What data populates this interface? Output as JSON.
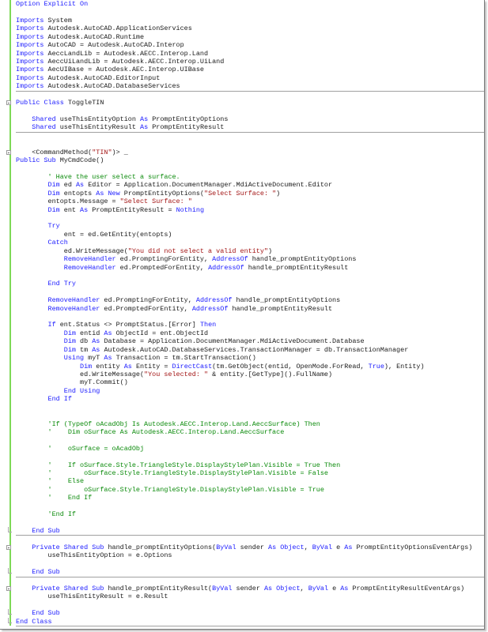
{
  "colors": {
    "keyword": "#1a1aff",
    "string": "#a31515",
    "comment": "#0a8a0a",
    "text": "#1a1a1a"
  },
  "lines": [
    {
      "segs": [
        [
          "k",
          "Option Explicit On"
        ]
      ]
    },
    {
      "segs": []
    },
    {
      "segs": [
        [
          "k",
          "Imports"
        ],
        [
          "p",
          " System"
        ]
      ]
    },
    {
      "segs": [
        [
          "k",
          "Imports"
        ],
        [
          "p",
          " Autodesk.AutoCAD.ApplicationServices"
        ]
      ]
    },
    {
      "segs": [
        [
          "k",
          "Imports"
        ],
        [
          "p",
          " Autodesk.AutoCAD.Runtime"
        ]
      ]
    },
    {
      "segs": [
        [
          "k",
          "Imports"
        ],
        [
          "p",
          " AutoCAD = Autodesk.AutoCAD.Interop"
        ]
      ]
    },
    {
      "segs": [
        [
          "k",
          "Imports"
        ],
        [
          "p",
          " AeccLandLib = Autodesk.AECC.Interop.Land"
        ]
      ]
    },
    {
      "segs": [
        [
          "k",
          "Imports"
        ],
        [
          "p",
          " AeccUiLandLib = Autodesk.AECC.Interop.UiLand"
        ]
      ]
    },
    {
      "segs": [
        [
          "k",
          "Imports"
        ],
        [
          "p",
          " AecUIBase = Autodesk.AEC.Interop.UIBase"
        ]
      ]
    },
    {
      "segs": [
        [
          "k",
          "Imports"
        ],
        [
          "p",
          " Autodesk.AutoCAD.EditorInput"
        ]
      ]
    },
    {
      "segs": [
        [
          "k",
          "Imports"
        ],
        [
          "p",
          " Autodesk.AutoCAD.DatabaseServices"
        ]
      ],
      "sep": true
    },
    {
      "segs": []
    },
    {
      "segs": [
        [
          "k",
          "Public Class"
        ],
        [
          "p",
          " ToggleTIN"
        ]
      ],
      "fold": "open"
    },
    {
      "segs": []
    },
    {
      "segs": [
        [
          "p",
          "    "
        ],
        [
          "k",
          "Shared"
        ],
        [
          "p",
          " useThisEntityOption "
        ],
        [
          "k",
          "As"
        ],
        [
          "p",
          " PromptEntityOptions"
        ]
      ]
    },
    {
      "segs": [
        [
          "p",
          "    "
        ],
        [
          "k",
          "Shared"
        ],
        [
          "p",
          " useThisEntityResult "
        ],
        [
          "k",
          "As"
        ],
        [
          "p",
          " PromptEntityResult"
        ]
      ],
      "sep": true
    },
    {
      "segs": []
    },
    {
      "segs": []
    },
    {
      "segs": [
        [
          "p",
          "    <CommandMethod("
        ],
        [
          "s",
          "\"TIN\""
        ],
        [
          "p",
          ")> _"
        ]
      ],
      "fold": "open"
    },
    {
      "segs": [
        [
          "k",
          "Public Sub"
        ],
        [
          "p",
          " MyCmdCode()"
        ]
      ]
    },
    {
      "segs": []
    },
    {
      "segs": [
        [
          "p",
          "        "
        ],
        [
          "c",
          "' Have the user select a surface."
        ]
      ]
    },
    {
      "segs": [
        [
          "p",
          "        "
        ],
        [
          "k",
          "Dim"
        ],
        [
          "p",
          " ed "
        ],
        [
          "k",
          "As"
        ],
        [
          "p",
          " Editor = Application.DocumentManager.MdiActiveDocument.Editor"
        ]
      ]
    },
    {
      "segs": [
        [
          "p",
          "        "
        ],
        [
          "k",
          "Dim"
        ],
        [
          "p",
          " entopts "
        ],
        [
          "k",
          "As New"
        ],
        [
          "p",
          " PromptEntityOptions("
        ],
        [
          "s",
          "\"Select Surface: \""
        ],
        [
          "p",
          ")"
        ]
      ]
    },
    {
      "segs": [
        [
          "p",
          "        entopts.Message = "
        ],
        [
          "s",
          "\"Select Surface: \""
        ]
      ]
    },
    {
      "segs": [
        [
          "p",
          "        "
        ],
        [
          "k",
          "Dim"
        ],
        [
          "p",
          " ent "
        ],
        [
          "k",
          "As"
        ],
        [
          "p",
          " PromptEntityResult = "
        ],
        [
          "k",
          "Nothing"
        ]
      ]
    },
    {
      "segs": []
    },
    {
      "segs": [
        [
          "p",
          "        "
        ],
        [
          "k",
          "Try"
        ]
      ]
    },
    {
      "segs": [
        [
          "p",
          "            ent = ed.GetEntity(entopts)"
        ]
      ]
    },
    {
      "segs": [
        [
          "p",
          "        "
        ],
        [
          "k",
          "Catch"
        ]
      ]
    },
    {
      "segs": [
        [
          "p",
          "            ed.WriteMessage("
        ],
        [
          "s",
          "\"You did not select a valid entity\""
        ],
        [
          "p",
          ")"
        ]
      ]
    },
    {
      "segs": [
        [
          "p",
          "            "
        ],
        [
          "k",
          "RemoveHandler"
        ],
        [
          "p",
          " ed.PromptingForEntity, "
        ],
        [
          "k",
          "AddressOf"
        ],
        [
          "p",
          " handle_promptEntityOptions"
        ]
      ]
    },
    {
      "segs": [
        [
          "p",
          "            "
        ],
        [
          "k",
          "RemoveHandler"
        ],
        [
          "p",
          " ed.PromptedForEntity, "
        ],
        [
          "k",
          "AddressOf"
        ],
        [
          "p",
          " handle_promptEntityResult"
        ]
      ]
    },
    {
      "segs": []
    },
    {
      "segs": [
        [
          "p",
          "        "
        ],
        [
          "k",
          "End Try"
        ]
      ]
    },
    {
      "segs": []
    },
    {
      "segs": [
        [
          "p",
          "        "
        ],
        [
          "k",
          "RemoveHandler"
        ],
        [
          "p",
          " ed.PromptingForEntity, "
        ],
        [
          "k",
          "AddressOf"
        ],
        [
          "p",
          " handle_promptEntityOptions"
        ]
      ]
    },
    {
      "segs": [
        [
          "p",
          "        "
        ],
        [
          "k",
          "RemoveHandler"
        ],
        [
          "p",
          " ed.PromptedForEntity, "
        ],
        [
          "k",
          "AddressOf"
        ],
        [
          "p",
          " handle_promptEntityResult"
        ]
      ]
    },
    {
      "segs": []
    },
    {
      "segs": [
        [
          "p",
          "        "
        ],
        [
          "k",
          "If"
        ],
        [
          "p",
          " ent.Status <> PromptStatus.[Error] "
        ],
        [
          "k",
          "Then"
        ]
      ]
    },
    {
      "segs": [
        [
          "p",
          "            "
        ],
        [
          "k",
          "Dim"
        ],
        [
          "p",
          " entid "
        ],
        [
          "k",
          "As"
        ],
        [
          "p",
          " ObjectId = ent.ObjectId"
        ]
      ]
    },
    {
      "segs": [
        [
          "p",
          "            "
        ],
        [
          "k",
          "Dim"
        ],
        [
          "p",
          " db "
        ],
        [
          "k",
          "As"
        ],
        [
          "p",
          " Database = Application.DocumentManager.MdiActiveDocument.Database"
        ]
      ]
    },
    {
      "segs": [
        [
          "p",
          "            "
        ],
        [
          "k",
          "Dim"
        ],
        [
          "p",
          " tm "
        ],
        [
          "k",
          "As"
        ],
        [
          "p",
          " Autodesk.AutoCAD.DatabaseServices.TransactionManager = db.TransactionManager"
        ]
      ]
    },
    {
      "segs": [
        [
          "p",
          "            "
        ],
        [
          "k",
          "Using"
        ],
        [
          "p",
          " myT "
        ],
        [
          "k",
          "As"
        ],
        [
          "p",
          " Transaction = tm.StartTransaction()"
        ]
      ]
    },
    {
      "segs": [
        [
          "p",
          "                "
        ],
        [
          "k",
          "Dim"
        ],
        [
          "p",
          " entity "
        ],
        [
          "k",
          "As"
        ],
        [
          "p",
          " Entity = "
        ],
        [
          "k",
          "DirectCast"
        ],
        [
          "p",
          "(tm.GetObject(entid, OpenMode.ForRead, "
        ],
        [
          "k",
          "True"
        ],
        [
          "p",
          "), Entity)"
        ]
      ]
    },
    {
      "segs": [
        [
          "p",
          "                ed.WriteMessage("
        ],
        [
          "s",
          "\"You selected: \""
        ],
        [
          "p",
          " & entity.[GetType]().FullName)"
        ]
      ]
    },
    {
      "segs": [
        [
          "p",
          "                myT.Commit()"
        ]
      ]
    },
    {
      "segs": [
        [
          "p",
          "            "
        ],
        [
          "k",
          "End Using"
        ]
      ]
    },
    {
      "segs": [
        [
          "p",
          "        "
        ],
        [
          "k",
          "End If"
        ]
      ]
    },
    {
      "segs": []
    },
    {
      "segs": []
    },
    {
      "segs": [
        [
          "p",
          "        "
        ],
        [
          "c",
          "'If (TypeOf oAcadObj Is Autodesk.AECC.Interop.Land.AeccSurface) Then"
        ]
      ]
    },
    {
      "segs": [
        [
          "p",
          "        "
        ],
        [
          "c",
          "'    Dim oSurface As Autodesk.AECC.Interop.Land.AeccSurface"
        ]
      ]
    },
    {
      "segs": []
    },
    {
      "segs": [
        [
          "p",
          "        "
        ],
        [
          "c",
          "'    oSurface = oAcadObj"
        ]
      ]
    },
    {
      "segs": []
    },
    {
      "segs": [
        [
          "p",
          "        "
        ],
        [
          "c",
          "'    If oSurface.Style.TriangleStyle.DisplayStylePlan.Visible = True Then"
        ]
      ]
    },
    {
      "segs": [
        [
          "p",
          "        "
        ],
        [
          "c",
          "'        oSurface.Style.TriangleStyle.DisplayStylePlan.Visible = False"
        ]
      ]
    },
    {
      "segs": [
        [
          "p",
          "        "
        ],
        [
          "c",
          "'    Else"
        ]
      ]
    },
    {
      "segs": [
        [
          "p",
          "        "
        ],
        [
          "c",
          "'        oSurface.Style.TriangleStyle.DisplayStylePlan.Visible = True"
        ]
      ]
    },
    {
      "segs": [
        [
          "p",
          "        "
        ],
        [
          "c",
          "'    End If"
        ]
      ]
    },
    {
      "segs": []
    },
    {
      "segs": [
        [
          "p",
          "        "
        ],
        [
          "c",
          "'End If"
        ]
      ]
    },
    {
      "segs": []
    },
    {
      "segs": [
        [
          "p",
          "    "
        ],
        [
          "k",
          "End Sub"
        ]
      ],
      "sep": true,
      "fold": "end"
    },
    {
      "segs": []
    },
    {
      "segs": [
        [
          "p",
          "    "
        ],
        [
          "k",
          "Private Shared Sub"
        ],
        [
          "p",
          " handle_promptEntityOptions("
        ],
        [
          "k",
          "ByVal"
        ],
        [
          "p",
          " sender "
        ],
        [
          "k",
          "As Object"
        ],
        [
          "p",
          ", "
        ],
        [
          "k",
          "ByVal"
        ],
        [
          "p",
          " e "
        ],
        [
          "k",
          "As"
        ],
        [
          "p",
          " PromptEntityOptionsEventArgs)"
        ]
      ],
      "fold": "open"
    },
    {
      "segs": [
        [
          "p",
          "        useThisEntityOption = e.Options"
        ]
      ]
    },
    {
      "segs": []
    },
    {
      "segs": [
        [
          "p",
          "    "
        ],
        [
          "k",
          "End Sub"
        ]
      ],
      "sep": true,
      "fold": "end"
    },
    {
      "segs": []
    },
    {
      "segs": [
        [
          "p",
          "    "
        ],
        [
          "k",
          "Private Shared Sub"
        ],
        [
          "p",
          " handle_promptEntityResult("
        ],
        [
          "k",
          "ByVal"
        ],
        [
          "p",
          " sender "
        ],
        [
          "k",
          "As Object"
        ],
        [
          "p",
          ", "
        ],
        [
          "k",
          "ByVal"
        ],
        [
          "p",
          " e "
        ],
        [
          "k",
          "As"
        ],
        [
          "p",
          " PromptEntityResultEventArgs)"
        ]
      ],
      "fold": "open"
    },
    {
      "segs": [
        [
          "p",
          "        useThisEntityResult = e.Result"
        ]
      ]
    },
    {
      "segs": []
    },
    {
      "segs": [
        [
          "p",
          "    "
        ],
        [
          "k",
          "End Sub"
        ]
      ],
      "fold": "end"
    },
    {
      "segs": [
        [
          "k",
          "End Class"
        ]
      ],
      "sep": true,
      "fold": "end"
    }
  ]
}
